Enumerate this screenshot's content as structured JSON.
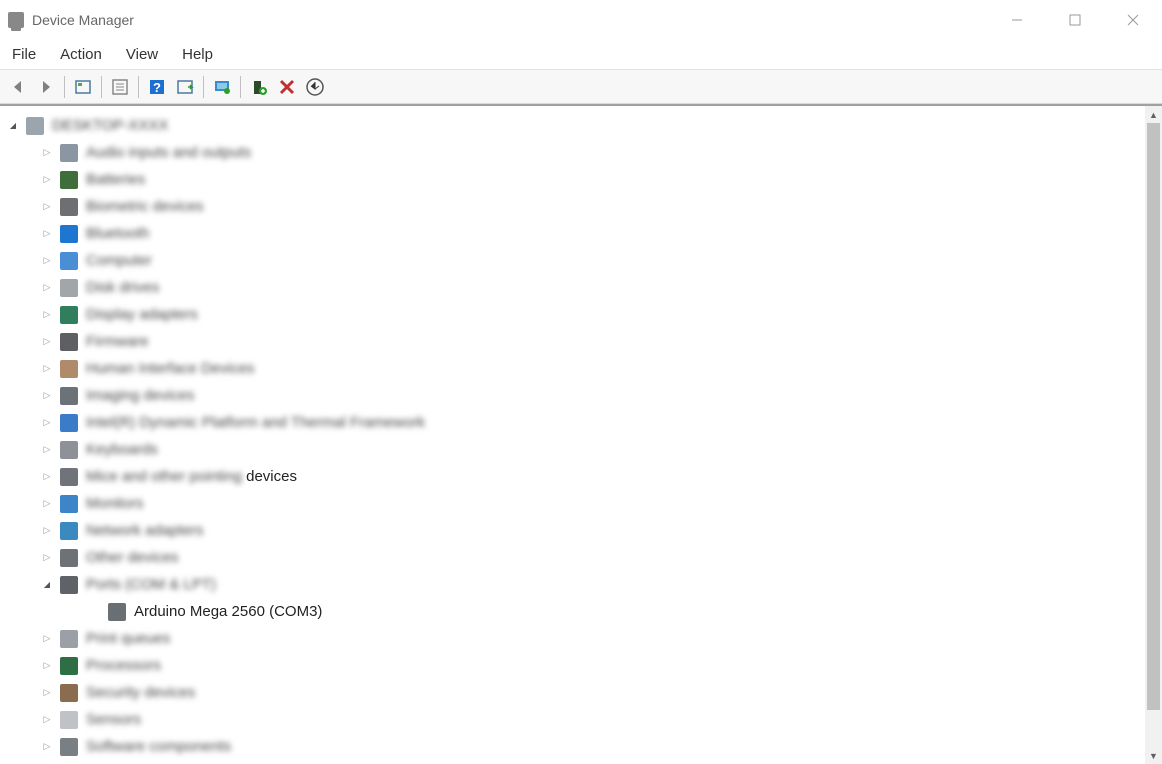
{
  "window": {
    "title": "Device Manager"
  },
  "menu": {
    "items": [
      "File",
      "Action",
      "View",
      "Help"
    ]
  },
  "toolbar": {
    "buttons": [
      {
        "name": "back-icon"
      },
      {
        "name": "forward-icon"
      },
      {
        "name": "show-hidden-icon"
      },
      {
        "name": "properties-icon"
      },
      {
        "name": "help-icon"
      },
      {
        "name": "scan-icon"
      },
      {
        "name": "monitor-icon"
      },
      {
        "name": "add-device-icon"
      },
      {
        "name": "remove-icon"
      },
      {
        "name": "update-icon"
      }
    ]
  },
  "tree": {
    "root": {
      "label": "DESKTOP-XXXX",
      "blurred": true,
      "iconColor": "#9aa5ad"
    },
    "categories": [
      {
        "label": "Audio inputs and outputs",
        "blurred": true,
        "iconColor": "#8a97a3"
      },
      {
        "label": "Batteries",
        "blurred": true,
        "iconColor": "#3e6e3a"
      },
      {
        "label": "Biometric devices",
        "blurred": true,
        "iconColor": "#6d6f73"
      },
      {
        "label": "Bluetooth",
        "blurred": true,
        "iconColor": "#1e76d0"
      },
      {
        "label": "Computer",
        "blurred": true,
        "iconColor": "#4a8fd6"
      },
      {
        "label": "Disk drives",
        "blurred": true,
        "iconColor": "#a1a6ab"
      },
      {
        "label": "Display adapters",
        "blurred": true,
        "iconColor": "#2f7f5f"
      },
      {
        "label": "Firmware",
        "blurred": true,
        "iconColor": "#5d5f62"
      },
      {
        "label": "Human Interface Devices",
        "blurred": true,
        "iconColor": "#b08b6a"
      },
      {
        "label": "Imaging devices",
        "blurred": true,
        "iconColor": "#6c7378"
      },
      {
        "label": "Intel(R) Dynamic Platform and Thermal Framework",
        "blurred": true,
        "iconColor": "#3a7cc7"
      },
      {
        "label": "Keyboards",
        "blurred": true,
        "iconColor": "#8d9298"
      },
      {
        "label": "Mice and other pointing devices",
        "blurred": false,
        "iconColor": "#6f737a",
        "partialBlur": true,
        "visibleSuffix": "devices"
      },
      {
        "label": "Monitors",
        "blurred": true,
        "iconColor": "#3d84c9"
      },
      {
        "label": "Network adapters",
        "blurred": true,
        "iconColor": "#3a8ac0"
      },
      {
        "label": "Other devices",
        "blurred": true,
        "iconColor": "#6d7277"
      },
      {
        "label": "Ports (COM & LPT)",
        "blurred": true,
        "iconColor": "#5f6368",
        "expanded": true,
        "children": [
          {
            "label": "Arduino Mega 2560 (COM3)",
            "blurred": false,
            "iconColor": "#6a6f74"
          }
        ]
      },
      {
        "label": "Print queues",
        "blurred": true,
        "iconColor": "#9aa0a6"
      },
      {
        "label": "Processors",
        "blurred": true,
        "iconColor": "#2e6e44"
      },
      {
        "label": "Security devices",
        "blurred": true,
        "iconColor": "#8a6d4e"
      },
      {
        "label": "Sensors",
        "blurred": true,
        "iconColor": "#bfc3c7"
      },
      {
        "label": "Software components",
        "blurred": true,
        "iconColor": "#7a7f84",
        "partialBlur": true,
        "visibleSuffix": ""
      }
    ]
  }
}
